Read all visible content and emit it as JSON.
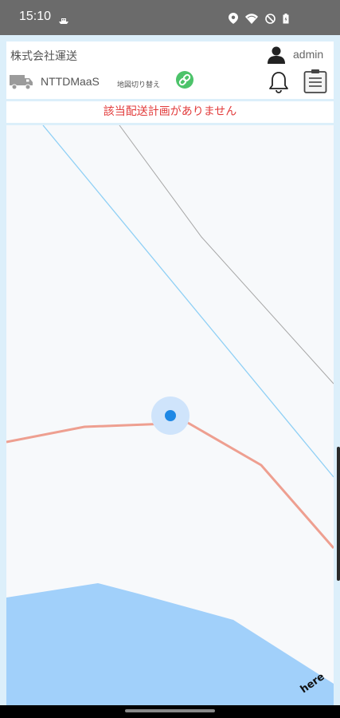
{
  "status_bar": {
    "time": "15:10",
    "icons": [
      "boat-icon",
      "location-icon",
      "wifi-icon",
      "do-not-disturb-icon",
      "battery-icon"
    ]
  },
  "header": {
    "company_name": "株式会社運送",
    "username": "admin",
    "vehicle_name": "NTTDMaaS",
    "map_switch_label": "地図切り替え",
    "icons": [
      "user-icon",
      "truck-icon",
      "link-icon",
      "bell-icon",
      "clipboard-icon"
    ]
  },
  "notice": {
    "message": "該当配送計画がありません"
  },
  "map": {
    "provider_logo": "here",
    "colors": {
      "water": "#a1d0fa",
      "road_red": "#ee9f90",
      "road_blue": "#8fd0f5",
      "road_gray": "#a6a6a6",
      "location_dot": "#1e88e5",
      "location_halo": "#cfe4fb",
      "link_button": "#4cc36a",
      "notice_text": "#e23b3b"
    }
  }
}
